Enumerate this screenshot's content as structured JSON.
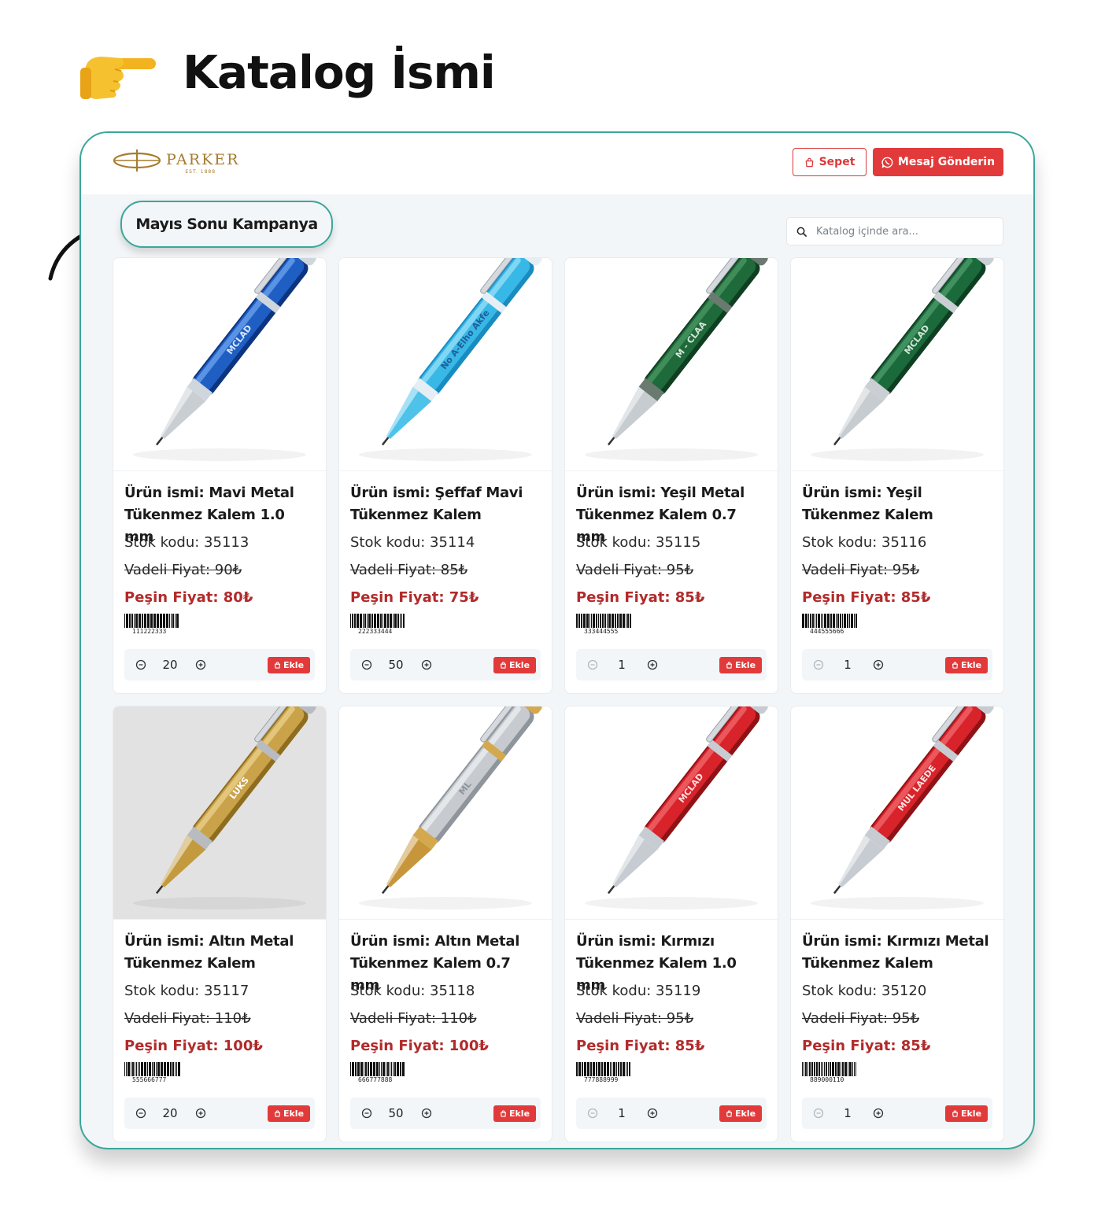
{
  "heading": {
    "title": "Katalog İsmi",
    "hand_icon": "pointing-hand-icon"
  },
  "header": {
    "brand": "PARKER",
    "brand_sub": "EST. 1888",
    "cart_label": "Sepet",
    "message_label": "Mesaj Gönderin"
  },
  "catalog": {
    "name": "Mayıs Sonu Kampanya"
  },
  "search": {
    "placeholder": "Katalog içinde ara..."
  },
  "colors": {
    "accent": "#3aa79b",
    "red": "#e23a3a",
    "price_red": "#b22a2a",
    "gold": "#a67c2e"
  },
  "products": [
    {
      "name": "Ürün ismi: Mavi Metal Tükenmez Kalem 1.0 mm",
      "code": "Stok kodu: 35113",
      "vadeli": "Vadeli Fiyat: 90₺",
      "pesin": "Peşin Fiyat: 80₺",
      "barcode": "111222333",
      "qty": "20",
      "add_label": "Ekle",
      "pen": "blue",
      "engraving": "MCLAD"
    },
    {
      "name": "Ürün ismi: Şeffaf Mavi Tükenmez Kalem",
      "code": "Stok kodu: 35114",
      "vadeli": "Vadeli Fiyat: 85₺",
      "pesin": "Peşin Fiyat: 75₺",
      "barcode": "222333444",
      "qty": "50",
      "add_label": "Ekle",
      "pen": "cyan",
      "engraving": "No A-Elho Akfe"
    },
    {
      "name": "Ürün ismi: Yeşil Metal Tükenmez Kalem 0.7 mm",
      "code": "Stok kodu: 35115",
      "vadeli": "Vadeli Fiyat: 95₺",
      "pesin": "Peşin Fiyat: 85₺",
      "barcode": "333444555",
      "qty": "1",
      "add_label": "Ekle",
      "pen": "green",
      "engraving": "M - CLAA"
    },
    {
      "name": "Ürün ismi: Yeşil Tükenmez Kalem",
      "code": "Stok kodu: 35116",
      "vadeli": "Vadeli Fiyat: 95₺",
      "pesin": "Peşin Fiyat: 85₺",
      "barcode": "444555666",
      "qty": "1",
      "add_label": "Ekle",
      "pen": "green2",
      "engraving": "MCLAD"
    },
    {
      "name": "Ürün ismi: Altın Metal Tükenmez Kalem",
      "code": "Stok kodu: 35117",
      "vadeli": "Vadeli Fiyat: 110₺",
      "pesin": "Peşin Fiyat: 100₺",
      "barcode": "555666777",
      "qty": "20",
      "add_label": "Ekle",
      "pen": "gold",
      "engraving": "LUKS"
    },
    {
      "name": "Ürün ismi: Altın Metal Tükenmez Kalem 0.7 mm",
      "code": "Stok kodu: 35118",
      "vadeli": "Vadeli Fiyat: 110₺",
      "pesin": "Peşin Fiyat: 100₺",
      "barcode": "666777888",
      "qty": "50",
      "add_label": "Ekle",
      "pen": "silvergold",
      "engraving": "ML"
    },
    {
      "name": "Ürün ismi: Kırmızı Tükenmez Kalem 1.0 mm",
      "code": "Stok kodu: 35119",
      "vadeli": "Vadeli Fiyat: 95₺",
      "pesin": "Peşin Fiyat: 85₺",
      "barcode": "777888999",
      "qty": "1",
      "add_label": "Ekle",
      "pen": "red",
      "engraving": "MCLAD"
    },
    {
      "name": "Ürün ismi: Kırmızı Metal Tükenmez Kalem",
      "code": "Stok kodu: 35120",
      "vadeli": "Vadeli Fiyat: 95₺",
      "pesin": "Peşin Fiyat: 85₺",
      "barcode": "889000110",
      "qty": "1",
      "add_label": "Ekle",
      "pen": "red2",
      "engraving": "MUL LAEDE"
    }
  ]
}
